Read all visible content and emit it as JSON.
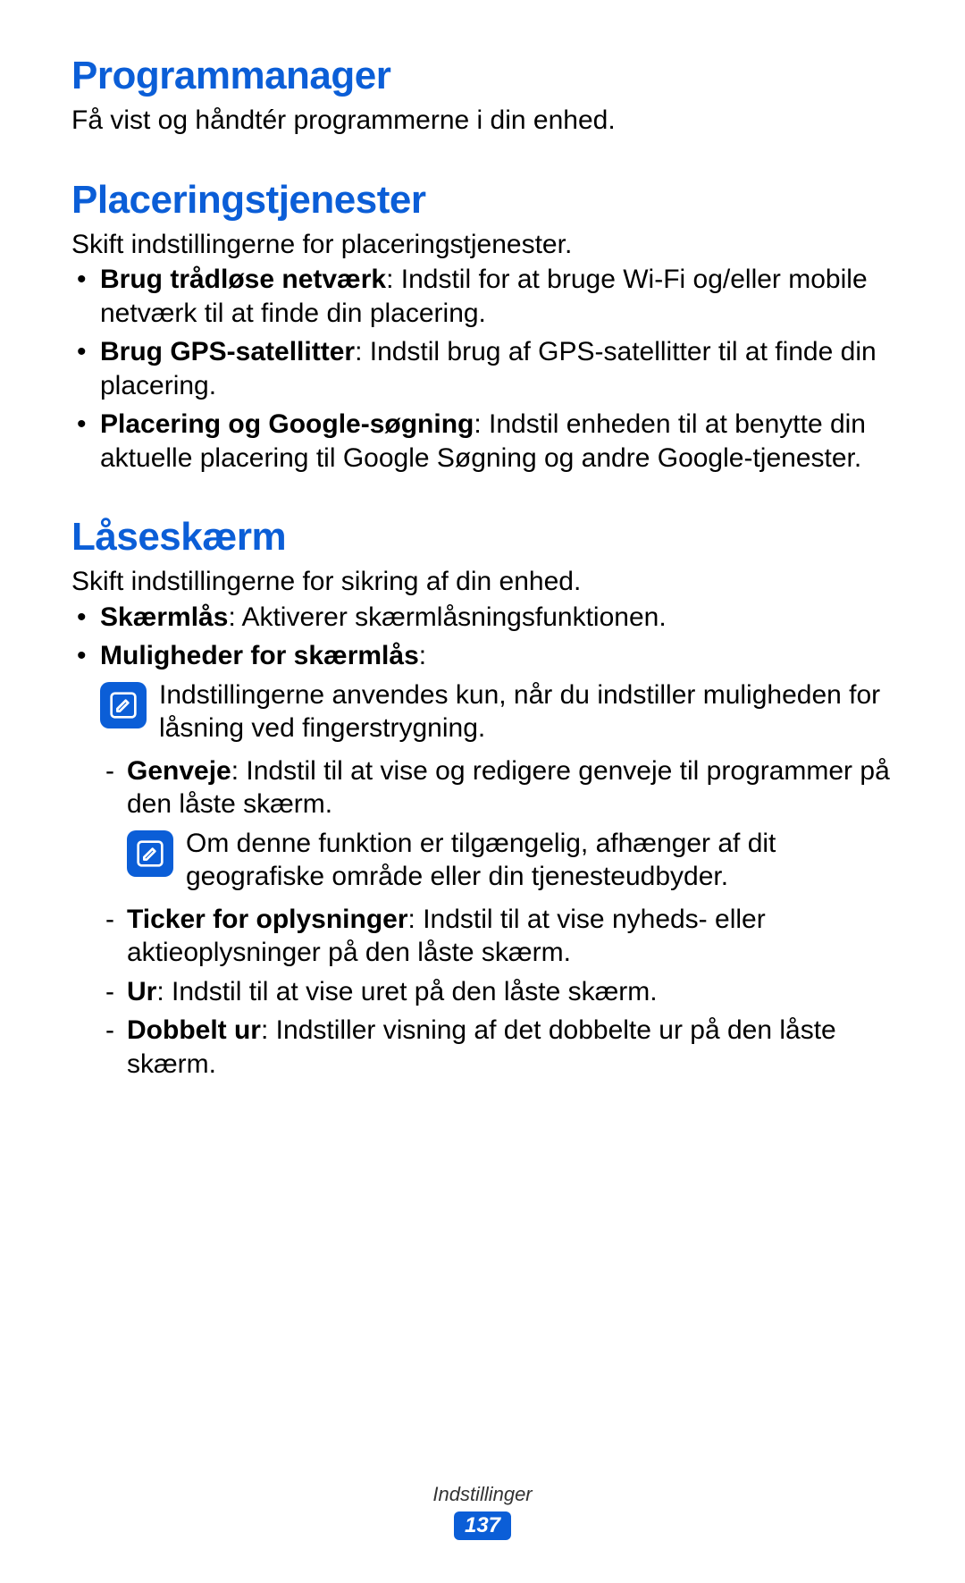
{
  "s1": {
    "heading": "Programmanager",
    "intro": "Få vist og håndtér programmerne i din enhed."
  },
  "s2": {
    "heading": "Placeringstjenester",
    "intro": "Skift indstillingerne for placeringstjenester.",
    "b1_label": "Brug trådløse netværk",
    "b1_text": ": Indstil for at bruge Wi-Fi og/eller mobile netværk til at finde din placering.",
    "b2_label": "Brug GPS-satellitter",
    "b2_text": ": Indstil brug af GPS-satellitter til at finde din placering.",
    "b3_label": "Placering og Google-søgning",
    "b3_text": ": Indstil enheden til at benytte din aktuelle placering til Google Søgning og andre Google-tjenester."
  },
  "s3": {
    "heading": "Låseskærm",
    "intro": "Skift indstillingerne for sikring af din enhed.",
    "b1_label": "Skærmlås",
    "b1_text": ": Aktiverer skærmlåsningsfunktionen.",
    "b2_label": "Muligheder for skærmlås",
    "b2_text": ":",
    "note1": "Indstillingerne anvendes kun, når du indstiller muligheden for låsning ved fingerstrygning.",
    "d1_label": "Genveje",
    "d1_text": ": Indstil til at vise og redigere genveje til programmer på den låste skærm.",
    "note2": "Om denne funktion er tilgængelig, afhænger af dit geografiske område eller din tjenesteudbyder.",
    "d2_label": "Ticker for oplysninger",
    "d2_text": ": Indstil til at vise nyheds- eller aktieoplysninger på den låste skærm.",
    "d3_label": "Ur",
    "d3_text": ": Indstil til at vise uret på den låste skærm.",
    "d4_label": "Dobbelt ur",
    "d4_text": ": Indstiller visning af det dobbelte ur på den låste skærm."
  },
  "footer": {
    "section": "Indstillinger",
    "page": "137"
  }
}
